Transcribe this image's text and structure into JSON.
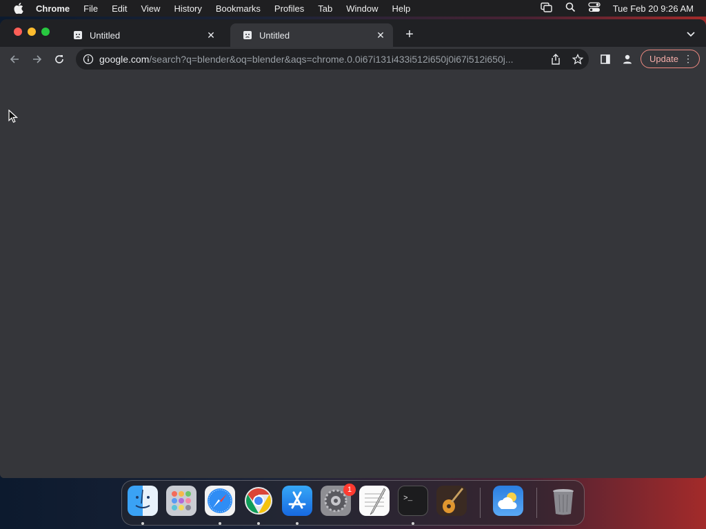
{
  "menubar": {
    "app_name": "Chrome",
    "items": [
      "File",
      "Edit",
      "View",
      "History",
      "Bookmarks",
      "Profiles",
      "Tab",
      "Window",
      "Help"
    ],
    "clock": "Tue Feb 20  9:26 AM",
    "status_icons": [
      "screen-mirroring-icon",
      "spotlight-search-icon",
      "control-center-icon"
    ]
  },
  "browser": {
    "tabs": [
      {
        "title": "Untitled",
        "active": false
      },
      {
        "title": "Untitled",
        "active": true
      }
    ],
    "url_host": "google.com",
    "url_rest": "/search?q=blender&oq=blender&aqs=chrome.0.0i67i131i433i512i650j0i67i512i650j...",
    "update_label": "Update"
  },
  "dock": {
    "apps": [
      {
        "name": "Finder",
        "running": true
      },
      {
        "name": "Launchpad",
        "running": false
      },
      {
        "name": "Safari",
        "running": true
      },
      {
        "name": "Google Chrome",
        "running": true
      },
      {
        "name": "App Store",
        "running": true
      },
      {
        "name": "System Settings",
        "running": false,
        "badge": "1"
      },
      {
        "name": "TextEdit",
        "running": false
      },
      {
        "name": "Terminal",
        "running": true
      },
      {
        "name": "GarageBand",
        "running": false
      },
      {
        "name": "Weather",
        "running": false
      },
      {
        "name": "Trash",
        "running": false
      }
    ]
  },
  "colors": {
    "window_bg": "#35363a",
    "tabstrip_bg": "#202124",
    "update_accent": "#f28b82"
  }
}
